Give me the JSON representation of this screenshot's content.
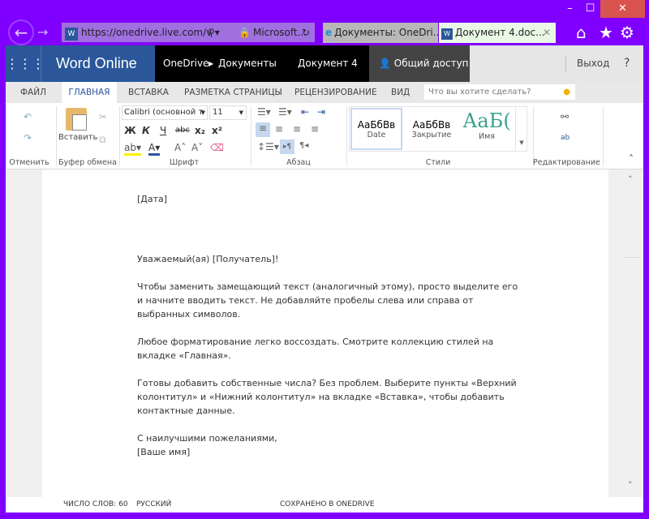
{
  "browser": {
    "url": "https://onedrive.live.com/v",
    "site_label": "Microsoft...",
    "tabs": [
      {
        "label": "Документы: OneDri..."
      },
      {
        "label": "Документ 4.doc..."
      }
    ]
  },
  "app": {
    "name": "Word Online",
    "breadcrumb_root": "OneDrive",
    "breadcrumb_folder": "Документы",
    "doc_title": "Документ 4",
    "share": "Общий доступ",
    "signout": "Выход",
    "help": "?"
  },
  "ribbon": {
    "tabs": [
      "ФАЙЛ",
      "ГЛАВНАЯ",
      "ВСТАВКА",
      "РАЗМЕТКА СТРАНИЦЫ",
      "РЕЦЕНЗИРОВАНИЕ",
      "ВИД"
    ],
    "active_tab": "ГЛАВНАЯ",
    "search_placeholder": "Что вы хотите сделать?",
    "groups": {
      "undo": "Отменить",
      "clipboard": "Буфер обмена",
      "font": "Шрифт",
      "paragraph": "Абзац",
      "styles": "Стили",
      "editing": "Редактирование"
    },
    "paste": "Вставить",
    "font_name": "Calibri (основной т",
    "font_size": "11",
    "styles": [
      {
        "preview": "АаБбВв",
        "name": "Date"
      },
      {
        "preview": "АаБбВв",
        "name": "Закрытие"
      },
      {
        "preview": "АаБ(",
        "name": "Имя"
      }
    ]
  },
  "document": {
    "paragraphs": [
      "[Дата]",
      "Уважаемый(ая) [Получатель]!",
      "Чтобы заменить замещающий текст (аналогичный этому), просто выделите его и начните вводить текст. Не добавляйте пробелы слева или справа от выбранных символов.",
      "Любое форматирование легко воссоздать. Смотрите коллекцию стилей на вкладке «Главная».",
      "Готовы добавить собственные числа? Без проблем. Выберите пункты «Верхний колонтитул» и «Нижний колонтитул» на вкладке «Вставка», чтобы добавить контактные данные.",
      "С наилучшими пожеланиями,",
      "[Ваше имя]"
    ]
  },
  "status": {
    "word_count": "ЧИСЛО СЛОВ: 60",
    "language": "РУССКИЙ",
    "save_state": "СОХРАНЕНО В ONEDRIVE"
  },
  "colors": {
    "frame": "#8000ff",
    "word_blue": "#2b579a",
    "style_accent": "#3aa18a"
  }
}
